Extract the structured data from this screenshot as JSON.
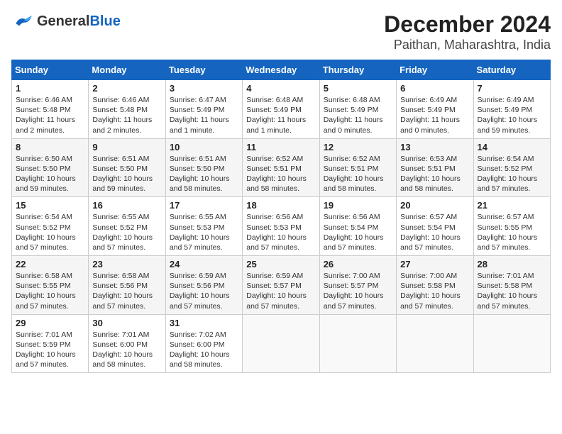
{
  "header": {
    "logo_general": "General",
    "logo_blue": "Blue",
    "title": "December 2024",
    "subtitle": "Paithan, Maharashtra, India"
  },
  "calendar": {
    "columns": [
      "Sunday",
      "Monday",
      "Tuesday",
      "Wednesday",
      "Thursday",
      "Friday",
      "Saturday"
    ],
    "weeks": [
      [
        null,
        null,
        null,
        null,
        null,
        null,
        null,
        {
          "day": "1",
          "sunrise": "Sunrise: 6:46 AM",
          "sunset": "Sunset: 5:48 PM",
          "daylight": "Daylight: 11 hours and 2 minutes."
        },
        {
          "day": "2",
          "sunrise": "Sunrise: 6:46 AM",
          "sunset": "Sunset: 5:48 PM",
          "daylight": "Daylight: 11 hours and 2 minutes."
        },
        {
          "day": "3",
          "sunrise": "Sunrise: 6:47 AM",
          "sunset": "Sunset: 5:49 PM",
          "daylight": "Daylight: 11 hours and 1 minute."
        },
        {
          "day": "4",
          "sunrise": "Sunrise: 6:48 AM",
          "sunset": "Sunset: 5:49 PM",
          "daylight": "Daylight: 11 hours and 1 minute."
        },
        {
          "day": "5",
          "sunrise": "Sunrise: 6:48 AM",
          "sunset": "Sunset: 5:49 PM",
          "daylight": "Daylight: 11 hours and 0 minutes."
        },
        {
          "day": "6",
          "sunrise": "Sunrise: 6:49 AM",
          "sunset": "Sunset: 5:49 PM",
          "daylight": "Daylight: 11 hours and 0 minutes."
        },
        {
          "day": "7",
          "sunrise": "Sunrise: 6:49 AM",
          "sunset": "Sunset: 5:49 PM",
          "daylight": "Daylight: 10 hours and 59 minutes."
        }
      ],
      [
        {
          "day": "8",
          "sunrise": "Sunrise: 6:50 AM",
          "sunset": "Sunset: 5:50 PM",
          "daylight": "Daylight: 10 hours and 59 minutes."
        },
        {
          "day": "9",
          "sunrise": "Sunrise: 6:51 AM",
          "sunset": "Sunset: 5:50 PM",
          "daylight": "Daylight: 10 hours and 59 minutes."
        },
        {
          "day": "10",
          "sunrise": "Sunrise: 6:51 AM",
          "sunset": "Sunset: 5:50 PM",
          "daylight": "Daylight: 10 hours and 58 minutes."
        },
        {
          "day": "11",
          "sunrise": "Sunrise: 6:52 AM",
          "sunset": "Sunset: 5:51 PM",
          "daylight": "Daylight: 10 hours and 58 minutes."
        },
        {
          "day": "12",
          "sunrise": "Sunrise: 6:52 AM",
          "sunset": "Sunset: 5:51 PM",
          "daylight": "Daylight: 10 hours and 58 minutes."
        },
        {
          "day": "13",
          "sunrise": "Sunrise: 6:53 AM",
          "sunset": "Sunset: 5:51 PM",
          "daylight": "Daylight: 10 hours and 58 minutes."
        },
        {
          "day": "14",
          "sunrise": "Sunrise: 6:54 AM",
          "sunset": "Sunset: 5:52 PM",
          "daylight": "Daylight: 10 hours and 57 minutes."
        }
      ],
      [
        {
          "day": "15",
          "sunrise": "Sunrise: 6:54 AM",
          "sunset": "Sunset: 5:52 PM",
          "daylight": "Daylight: 10 hours and 57 minutes."
        },
        {
          "day": "16",
          "sunrise": "Sunrise: 6:55 AM",
          "sunset": "Sunset: 5:52 PM",
          "daylight": "Daylight: 10 hours and 57 minutes."
        },
        {
          "day": "17",
          "sunrise": "Sunrise: 6:55 AM",
          "sunset": "Sunset: 5:53 PM",
          "daylight": "Daylight: 10 hours and 57 minutes."
        },
        {
          "day": "18",
          "sunrise": "Sunrise: 6:56 AM",
          "sunset": "Sunset: 5:53 PM",
          "daylight": "Daylight: 10 hours and 57 minutes."
        },
        {
          "day": "19",
          "sunrise": "Sunrise: 6:56 AM",
          "sunset": "Sunset: 5:54 PM",
          "daylight": "Daylight: 10 hours and 57 minutes."
        },
        {
          "day": "20",
          "sunrise": "Sunrise: 6:57 AM",
          "sunset": "Sunset: 5:54 PM",
          "daylight": "Daylight: 10 hours and 57 minutes."
        },
        {
          "day": "21",
          "sunrise": "Sunrise: 6:57 AM",
          "sunset": "Sunset: 5:55 PM",
          "daylight": "Daylight: 10 hours and 57 minutes."
        }
      ],
      [
        {
          "day": "22",
          "sunrise": "Sunrise: 6:58 AM",
          "sunset": "Sunset: 5:55 PM",
          "daylight": "Daylight: 10 hours and 57 minutes."
        },
        {
          "day": "23",
          "sunrise": "Sunrise: 6:58 AM",
          "sunset": "Sunset: 5:56 PM",
          "daylight": "Daylight: 10 hours and 57 minutes."
        },
        {
          "day": "24",
          "sunrise": "Sunrise: 6:59 AM",
          "sunset": "Sunset: 5:56 PM",
          "daylight": "Daylight: 10 hours and 57 minutes."
        },
        {
          "day": "25",
          "sunrise": "Sunrise: 6:59 AM",
          "sunset": "Sunset: 5:57 PM",
          "daylight": "Daylight: 10 hours and 57 minutes."
        },
        {
          "day": "26",
          "sunrise": "Sunrise: 7:00 AM",
          "sunset": "Sunset: 5:57 PM",
          "daylight": "Daylight: 10 hours and 57 minutes."
        },
        {
          "day": "27",
          "sunrise": "Sunrise: 7:00 AM",
          "sunset": "Sunset: 5:58 PM",
          "daylight": "Daylight: 10 hours and 57 minutes."
        },
        {
          "day": "28",
          "sunrise": "Sunrise: 7:01 AM",
          "sunset": "Sunset: 5:58 PM",
          "daylight": "Daylight: 10 hours and 57 minutes."
        }
      ],
      [
        {
          "day": "29",
          "sunrise": "Sunrise: 7:01 AM",
          "sunset": "Sunset: 5:59 PM",
          "daylight": "Daylight: 10 hours and 57 minutes."
        },
        {
          "day": "30",
          "sunrise": "Sunrise: 7:01 AM",
          "sunset": "Sunset: 6:00 PM",
          "daylight": "Daylight: 10 hours and 58 minutes."
        },
        {
          "day": "31",
          "sunrise": "Sunrise: 7:02 AM",
          "sunset": "Sunset: 6:00 PM",
          "daylight": "Daylight: 10 hours and 58 minutes."
        },
        null,
        null,
        null,
        null
      ]
    ]
  }
}
